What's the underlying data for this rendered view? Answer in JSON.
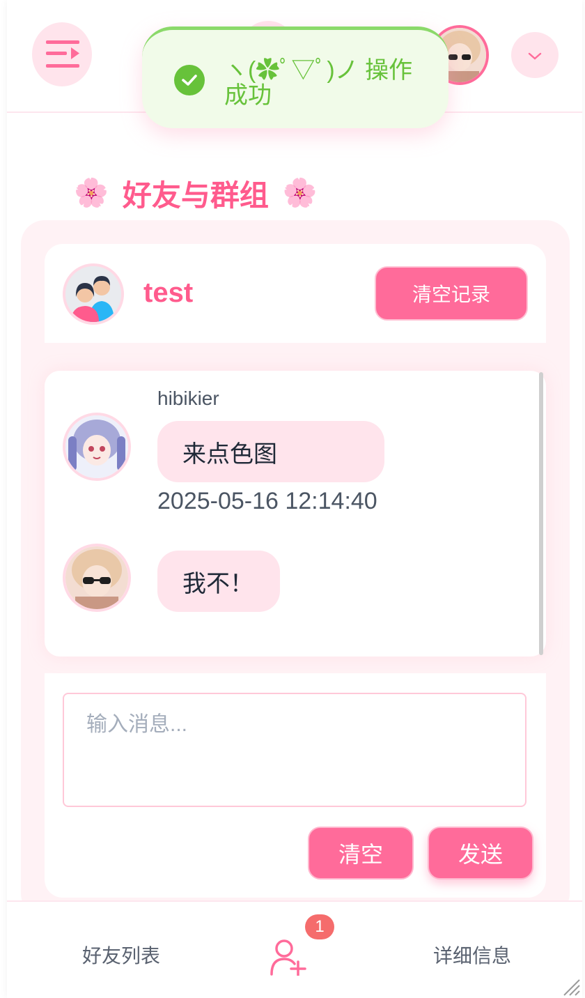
{
  "toast": {
    "message": "ヽ(✿ﾟ▽ﾟ)ノ 操作成功",
    "icon": "check-circle-icon"
  },
  "section": {
    "title": "好友与群组",
    "decoration_icon": "sakura-icon",
    "decoration_glyph": "🌸"
  },
  "chat": {
    "name": "test",
    "clear_record_label": "清空记录",
    "messages": [
      {
        "sender": "hibikier",
        "text": "来点色图",
        "time": "2025-05-16 12:14:40"
      },
      {
        "sender": "",
        "text": "我不！",
        "time": ""
      }
    ]
  },
  "composer": {
    "placeholder": "输入消息...",
    "clear_label": "清空",
    "send_label": "发送"
  },
  "bottom_nav": {
    "friends_label": "好友列表",
    "details_label": "详细信息",
    "notification_count": "1"
  },
  "colors": {
    "accent": "#ff6b9a",
    "title": "#ff5b8d",
    "bubble": "#ffe4ec",
    "toast_green": "#67c23a",
    "badge": "#f56c6c"
  }
}
